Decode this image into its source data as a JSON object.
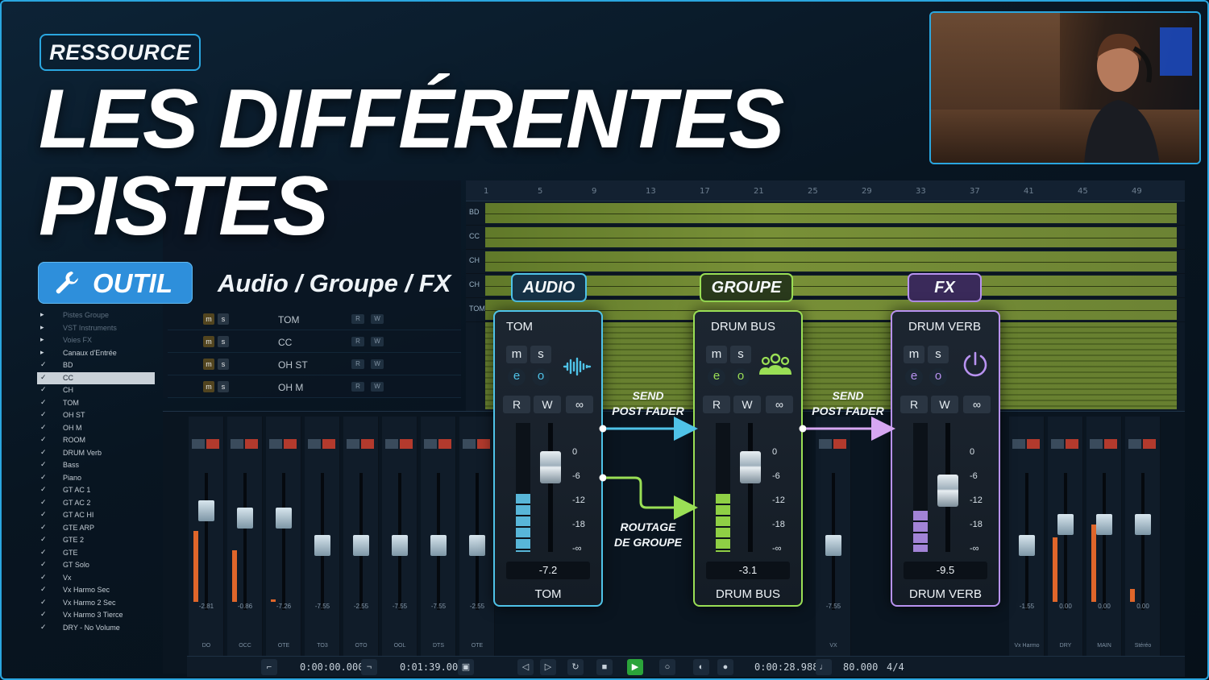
{
  "header": {
    "tag": "RESSOURCE",
    "title_line1": "LES DIFFÉRENTES",
    "title_line2": "PISTES",
    "tool_label": "OUTIL",
    "subtitle": "Audio / Groupe / FX"
  },
  "ruler": [
    "1",
    "5",
    "9",
    "13",
    "17",
    "21",
    "25",
    "29",
    "33",
    "37",
    "41",
    "45",
    "49"
  ],
  "lanes": [
    "BD",
    "CC",
    "CH",
    "CH",
    "TOM"
  ],
  "track_rows": [
    {
      "name": "TOM"
    },
    {
      "name": "CC"
    },
    {
      "name": "OH ST"
    },
    {
      "name": "OH M"
    }
  ],
  "tracklist": {
    "items": [
      {
        "label": "Pistes Groupe",
        "checked": false,
        "dim": true
      },
      {
        "label": "VST Instruments",
        "checked": false,
        "dim": true
      },
      {
        "label": "Voies FX",
        "checked": false,
        "dim": true
      },
      {
        "label": "Canaux d'Entrée",
        "checked": false,
        "dim": false
      },
      {
        "label": "BD",
        "checked": true,
        "dim": false
      },
      {
        "label": "CC",
        "checked": true,
        "dim": false,
        "selected": true
      },
      {
        "label": "CH",
        "checked": true,
        "dim": false
      },
      {
        "label": "TOM",
        "checked": true,
        "dim": false
      },
      {
        "label": "OH ST",
        "checked": true,
        "dim": false
      },
      {
        "label": "OH M",
        "checked": true,
        "dim": false
      },
      {
        "label": "ROOM",
        "checked": true,
        "dim": false
      },
      {
        "label": "DRUM Verb",
        "checked": true,
        "dim": false
      },
      {
        "label": "Bass",
        "checked": true,
        "dim": false
      },
      {
        "label": "Piano",
        "checked": true,
        "dim": false
      },
      {
        "label": "GT AC 1",
        "checked": true,
        "dim": false
      },
      {
        "label": "GT AC 2",
        "checked": true,
        "dim": false
      },
      {
        "label": "GT AC HI",
        "checked": true,
        "dim": false
      },
      {
        "label": "GTE ARP",
        "checked": true,
        "dim": false
      },
      {
        "label": "GTE 2",
        "checked": true,
        "dim": false
      },
      {
        "label": "GTE",
        "checked": true,
        "dim": false
      },
      {
        "label": "GT Solo",
        "checked": true,
        "dim": false
      },
      {
        "label": "Vx",
        "checked": true,
        "dim": false
      },
      {
        "label": "Vx Harmo Sec",
        "checked": true,
        "dim": false
      },
      {
        "label": "Vx Harmo 2 Sec",
        "checked": true,
        "dim": false
      },
      {
        "label": "Vx Harmo 3 Tierce",
        "checked": true,
        "dim": false
      },
      {
        "label": "DRY - No Volume",
        "checked": true,
        "dim": false
      }
    ]
  },
  "mixer_strips": [
    {
      "val": "-2.81",
      "name": "DO",
      "meter": 0.55,
      "fader": 0.2
    },
    {
      "val": "-0.86",
      "name": "OCC",
      "meter": 0.4,
      "fader": 0.25
    },
    {
      "val": "-7.26",
      "name": "OTE",
      "meter": 0.02,
      "fader": 0.25
    },
    {
      "val": "-7.55",
      "name": "TO3",
      "meter": 0,
      "fader": 0.45
    },
    {
      "val": "-2.55",
      "name": "OTO",
      "meter": 0,
      "fader": 0.45
    },
    {
      "val": "-7.55",
      "name": "OOL",
      "meter": 0,
      "fader": 0.45
    },
    {
      "val": "-7.55",
      "name": "DTS",
      "meter": 0,
      "fader": 0.45
    },
    {
      "val": "-2.55",
      "name": "OTE",
      "meter": 0,
      "fader": 0.45
    },
    {
      "val": "-7.55",
      "name": "VX",
      "meter": 0,
      "fader": 0.45
    },
    {
      "val": "-1.55",
      "name": "Vx Harmo",
      "meter": 0,
      "fader": 0.45
    },
    {
      "val": "0.00",
      "name": "DRY",
      "meter": 0.5,
      "fader": 0.3
    },
    {
      "val": "0.00",
      "name": "MAIN",
      "meter": 0.6,
      "fader": 0.3
    },
    {
      "val": "0.00",
      "name": "Stéréo",
      "meter": 0.1,
      "fader": 0.3
    }
  ],
  "transport": {
    "left_locator": "0:00:00.000",
    "right_locator": "0:01:39.000",
    "position": "0:00:28.988",
    "tempo": "80.000",
    "signature": "4/4"
  },
  "cards": {
    "audio": {
      "pill": "AUDIO",
      "title": "TOM",
      "footer": "TOM",
      "value": "-7.2",
      "m": "m",
      "s": "s",
      "e": "e",
      "o": "o",
      "r": "R",
      "w": "W",
      "link": "∞",
      "meter_level": 0.45,
      "fader_level": 0.78,
      "accent": "#4fc3e8",
      "meter_color": "#58b6d8"
    },
    "group": {
      "pill": "GROUPE",
      "title": "DRUM BUS",
      "footer": "DRUM BUS",
      "value": "-3.1",
      "m": "m",
      "s": "s",
      "e": "e",
      "o": "o",
      "r": "R",
      "w": "W",
      "link": "∞",
      "meter_level": 0.45,
      "fader_level": 0.78,
      "accent": "#9adf55",
      "meter_color": "#8fcf45"
    },
    "fx": {
      "pill": "FX",
      "title": "DRUM VERB",
      "footer": "DRUM VERB",
      "value": "-9.5",
      "m": "m",
      "s": "s",
      "e": "e",
      "o": "o",
      "r": "R",
      "w": "W",
      "link": "∞",
      "meter_level": 0.32,
      "fader_level": 0.6,
      "accent": "#b892f0",
      "meter_color": "#a283d6"
    },
    "scale": [
      "0",
      "-6",
      "-12",
      "-18",
      "-∞"
    ]
  },
  "routes": {
    "send1": "SEND\nPOST FADER",
    "routage": "ROUTAGE\nDE GROUPE",
    "send2": "SEND\nPOST FADER"
  }
}
